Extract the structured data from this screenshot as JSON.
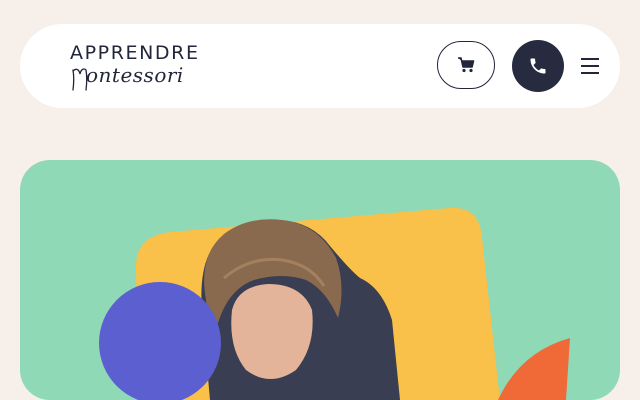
{
  "logo": {
    "line1": "APPRENDRE",
    "line2": "ontessori"
  },
  "header": {
    "cart_icon": "cart-icon",
    "phone_icon": "phone-icon",
    "menu_icon": "hamburger-menu-icon"
  },
  "colors": {
    "background": "#f7efe9",
    "header_bg": "#ffffff",
    "dark": "#262b40",
    "hero_green": "#8fd9b6",
    "hero_yellow": "#f9c04a",
    "hero_blue": "#5b5fd0",
    "hero_orange": "#f06a38"
  }
}
